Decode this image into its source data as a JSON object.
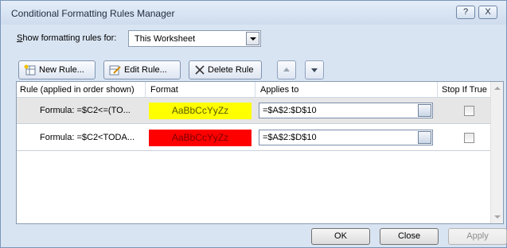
{
  "window": {
    "title": "Conditional Formatting Rules Manager",
    "help_label": "?",
    "close_label": "X"
  },
  "show_rules": {
    "label": "Show formatting rules for:",
    "selected": "This Worksheet"
  },
  "toolbar": {
    "new_rule": "New Rule...",
    "edit_rule": "Edit Rule...",
    "delete_rule": "Delete Rule"
  },
  "table": {
    "columns": [
      "Rule (applied in order shown)",
      "Format",
      "Applies to",
      "Stop If True"
    ],
    "rows": [
      {
        "rule": "Formula: =$C2<=(TO...",
        "format_preview": "AaBbCcYyZz",
        "format_color": "#ffff00",
        "applies_to": "=$A$2:$D$10",
        "stop_if_true": false,
        "selected": true
      },
      {
        "rule": "Formula: =$C2<TODA...",
        "format_preview": "AaBbCcYyZz",
        "format_color": "#ff0000",
        "applies_to": "=$A$2:$D$10",
        "stop_if_true": false,
        "selected": false
      }
    ]
  },
  "footer": {
    "ok": "OK",
    "close": "Close",
    "apply": "Apply"
  },
  "colors": {
    "dialog_bg": "#d9e4f2",
    "selected_row": "#e6e6e6",
    "format_yellow": "#ffff00",
    "format_red": "#ff0000"
  }
}
